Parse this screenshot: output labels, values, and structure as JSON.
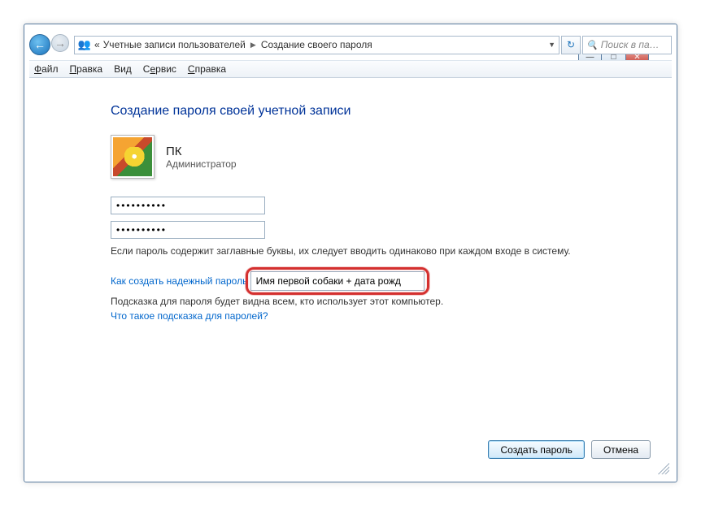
{
  "titlebar": {
    "minimize": "—",
    "maximize": "□",
    "close": "✕"
  },
  "nav": {
    "back": "←",
    "forward": "→",
    "crumb_prefix": "«",
    "crumb1": "Учетные записи пользователей",
    "crumb2": "Создание своего пароля",
    "refresh": "↻",
    "search_placeholder": "Поиск в па…"
  },
  "menu": {
    "file": "Файл",
    "edit": "Правка",
    "view": "Вид",
    "service": "Сервис",
    "help": "Справка"
  },
  "page": {
    "heading": "Создание пароля своей учетной записи",
    "user_name": "ПК",
    "user_role": "Администратор",
    "password1": "••••••••••",
    "password2": "••••••••••",
    "caps_note": "Если пароль содержит заглавные буквы, их следует вводить одинаково при каждом входе в систему.",
    "strong_link": "Как создать надежный пароль",
    "hint_value": "Имя первой собаки + дата рожд",
    "hint_note": "Подсказка для пароля будет видна всем, кто использует этот компьютер.",
    "hint_link": "Что такое подсказка для паролей?"
  },
  "buttons": {
    "create": "Создать пароль",
    "cancel": "Отмена"
  }
}
